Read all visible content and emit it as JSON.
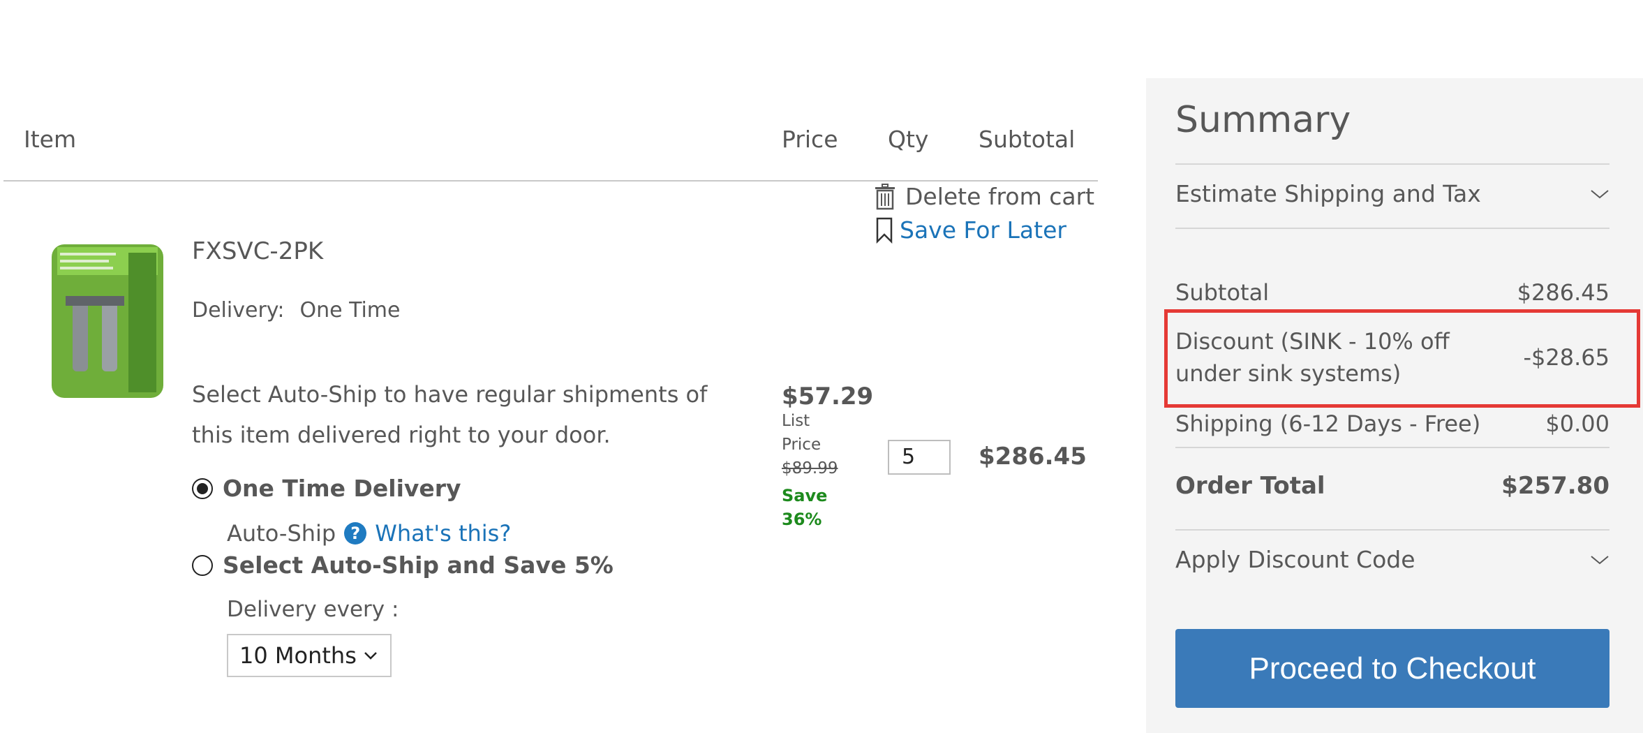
{
  "table": {
    "headers": {
      "item": "Item",
      "price": "Price",
      "qty": "Qty",
      "subtotal": "Subtotal"
    }
  },
  "actions": {
    "delete": "Delete from cart",
    "save_for_later": "Save For Later"
  },
  "item": {
    "name": "FXSVC-2PK",
    "delivery_label": "Delivery:",
    "delivery_value": "One Time",
    "autoship_intro": "Select Auto-Ship to have regular shipments of this item delivered right to your door.",
    "option_one_time": "One Time Delivery",
    "autoship_label": "Auto-Ship",
    "whats_this": "What's this?",
    "option_autoship": "Select Auto-Ship and Save 5%",
    "delivery_every_label": "Delivery every :",
    "delivery_every_value": "10 Months",
    "one_time_selected": true,
    "price": "$57.29",
    "list_label": "List",
    "price_label": "Price",
    "list_price": "$89.99",
    "save_label": "Save",
    "save_percent": "36%",
    "qty": "5",
    "subtotal": "$286.45"
  },
  "summary": {
    "title": "Summary",
    "estimate": "Estimate Shipping and Tax",
    "subtotal_label": "Subtotal",
    "subtotal_value": "$286.45",
    "discount_label": "Discount (SINK - 10% off under sink systems)",
    "discount_value": "-$28.65",
    "shipping_label": "Shipping (6-12 Days - Free)",
    "shipping_value": "$0.00",
    "total_label": "Order Total",
    "total_value": "$257.80",
    "apply_code": "Apply Discount Code",
    "checkout": "Proceed to Checkout"
  },
  "colors": {
    "link": "#1a73b8",
    "save_green": "#1d8a1d",
    "checkout_blue": "#3a7ab9",
    "highlight_red": "#e53935",
    "summary_bg": "#f4f4f4"
  },
  "icons": [
    "trash-icon",
    "bookmark-icon",
    "help-icon",
    "chevron-down-icon",
    "radio-selected-icon",
    "radio-unselected-icon"
  ]
}
